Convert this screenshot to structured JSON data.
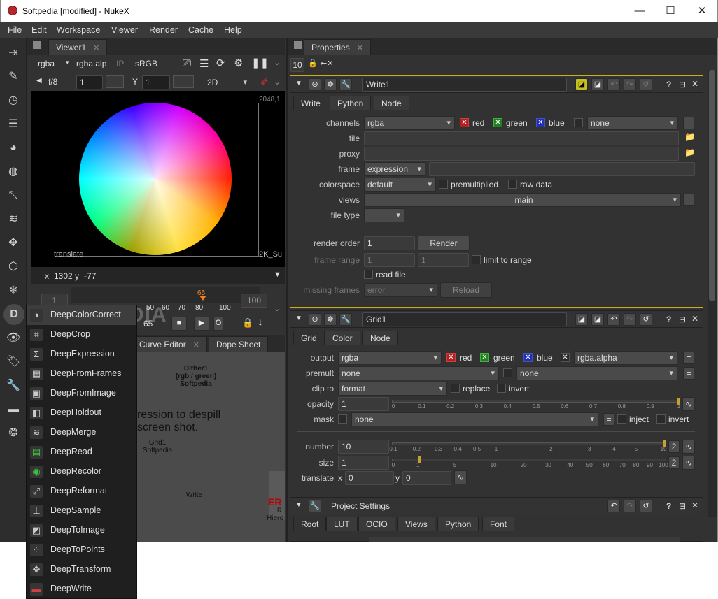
{
  "window": {
    "title": "Softpedia [modified] - NukeX",
    "minimize": "—",
    "maximize": "☐",
    "close": "✕"
  },
  "menu": [
    "File",
    "Edit",
    "Workspace",
    "Viewer",
    "Render",
    "Cache",
    "Help"
  ],
  "viewer": {
    "tab": "Viewer1",
    "channels": "rgba",
    "alpha": "rgba.alp",
    "ip": "IP",
    "colorspace": "sRGB",
    "fstop": "f/8",
    "gain": "1",
    "y_label": "Y",
    "gamma": "1",
    "mode": "2D",
    "res_label": "2048,1",
    "translate_label": "translate",
    "format_label": "2K_Su",
    "coords": "x=1302 y=-77",
    "frame_start": "1",
    "frame_end": "100",
    "current_frame": "65",
    "frame_field": "65",
    "ticks": [
      "50",
      "60",
      "70",
      "80",
      "100"
    ],
    "watermark": "SOFTPEDIA"
  },
  "lower_tabs": [
    "Curve Editor",
    "Dope Sheet"
  ],
  "nodegraph": {
    "dither": "Dither1\n(rgb / green)\nSoftpedia",
    "text1": "ression to despill",
    "text2": "screen shot.",
    "grid": "Grid1\nSoftpedia",
    "write": "Write",
    "err": "ER",
    "r": "R",
    "hier": "Hiero"
  },
  "dropdown": {
    "items": [
      "DeepColorCorrect",
      "DeepCrop",
      "DeepExpression",
      "DeepFromFrames",
      "DeepFromImage",
      "DeepHoldout",
      "DeepMerge",
      "DeepRead",
      "DeepRecolor",
      "DeepReformat",
      "DeepSample",
      "DeepToImage",
      "DeepToPoints",
      "DeepTransform",
      "DeepWrite"
    ]
  },
  "properties": {
    "tab": "Properties",
    "max_panels": "10",
    "write": {
      "name": "Write1",
      "tabs": [
        "Write",
        "Python",
        "Node"
      ],
      "channels_label": "channels",
      "channels": "rgba",
      "red": "red",
      "green": "green",
      "blue": "blue",
      "extra": "none",
      "file_label": "file",
      "proxy_label": "proxy",
      "frame_label": "frame",
      "frame": "expression",
      "colorspace_label": "colorspace",
      "colorspace": "default",
      "premultiplied": "premultiplied",
      "raw": "raw data",
      "views_label": "views",
      "views": "main",
      "filetype_label": "file type",
      "render_order_label": "render order",
      "render_order": "1",
      "render_btn": "Render",
      "frame_range_label": "frame range",
      "fr_start": "1",
      "fr_end": "1",
      "limit": "limit to range",
      "read_file": "read file",
      "missing_label": "missing frames",
      "missing": "error",
      "reload": "Reload"
    },
    "grid": {
      "name": "Grid1",
      "tabs": [
        "Grid",
        "Color",
        "Node"
      ],
      "output_label": "output",
      "output": "rgba",
      "red": "red",
      "green": "green",
      "blue": "blue",
      "alpha": "rgba.alpha",
      "premult_label": "premult",
      "premult": "none",
      "premult2": "none",
      "clip_label": "clip to",
      "clip": "format",
      "replace": "replace",
      "invert": "invert",
      "opacity_label": "opacity",
      "opacity": "1",
      "opacity_ticks": [
        "0",
        "0.1",
        "0.2",
        "0.3",
        "0.4",
        "0.5",
        "0.6",
        "0.7",
        "0.8",
        "0.9",
        "1"
      ],
      "mask_label": "mask",
      "mask": "none",
      "inject": "inject",
      "invert2": "invert",
      "number_label": "number",
      "number": "10",
      "number_ticks": [
        "0.1",
        "0.2",
        "0.3",
        "0.4",
        "0.5",
        "1",
        "2",
        "3",
        "4",
        "5",
        "10"
      ],
      "size_label": "size",
      "size": "1",
      "size_ticks": [
        "0",
        "1",
        "5",
        "10",
        "20",
        "30",
        "40",
        "50",
        "60",
        "70",
        "80",
        "90",
        "100"
      ],
      "translate_label": "translate",
      "tx_label": "x",
      "tx": "0",
      "ty_label": "y",
      "ty": "0",
      "two": "2"
    },
    "project": {
      "name": "Project Settings",
      "tabs": [
        "Root",
        "LUT",
        "OCIO",
        "Views",
        "Python",
        "Font"
      ]
    }
  }
}
